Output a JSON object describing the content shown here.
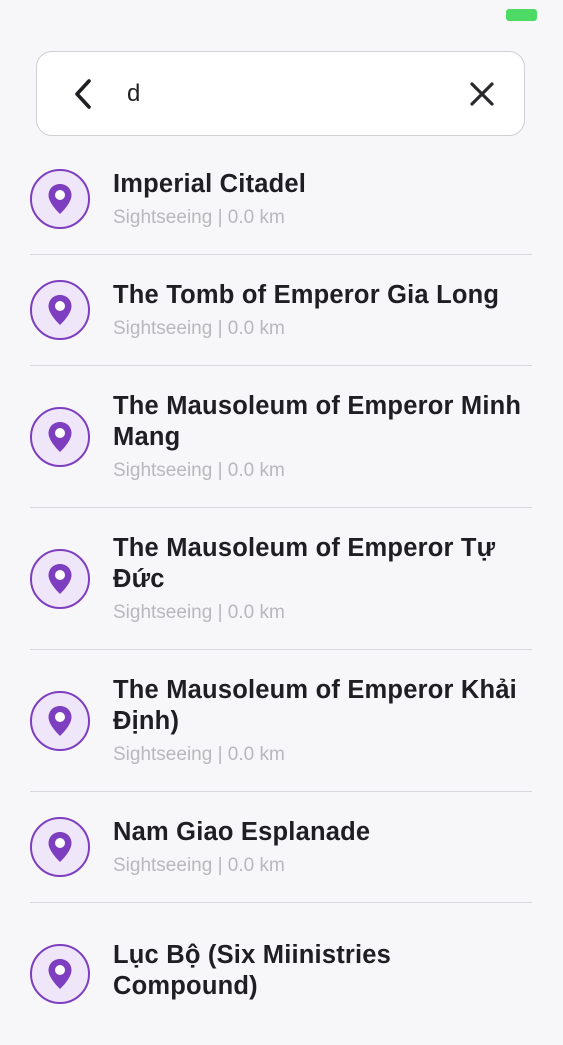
{
  "search": {
    "value": "d"
  },
  "results": [
    {
      "title": "Imperial Citadel",
      "subtitle": "Sightseeing | 0.0 km"
    },
    {
      "title": "The Tomb of Emperor Gia Long",
      "subtitle": "Sightseeing | 0.0 km"
    },
    {
      "title": "The Mausoleum of Emperor Minh Mang",
      "subtitle": "Sightseeing | 0.0 km"
    },
    {
      "title": "The Mausoleum of Emperor Tự Đức",
      "subtitle": "Sightseeing | 0.0 km"
    },
    {
      "title": "The Mausoleum of Emperor Khải Định)",
      "subtitle": "Sightseeing | 0.0 km"
    },
    {
      "title": "Nam Giao Esplanade",
      "subtitle": "Sightseeing | 0.0 km"
    },
    {
      "title": "Lục Bộ (Six Miinistries Compound)",
      "subtitle": ""
    }
  ],
  "colors": {
    "accent": "#7d3fbf",
    "pin_background": "#f0e6fa",
    "battery": "#4cd964"
  },
  "icons": {
    "back": "chevron-left-icon",
    "clear": "close-icon",
    "result": "map-pin-icon"
  }
}
